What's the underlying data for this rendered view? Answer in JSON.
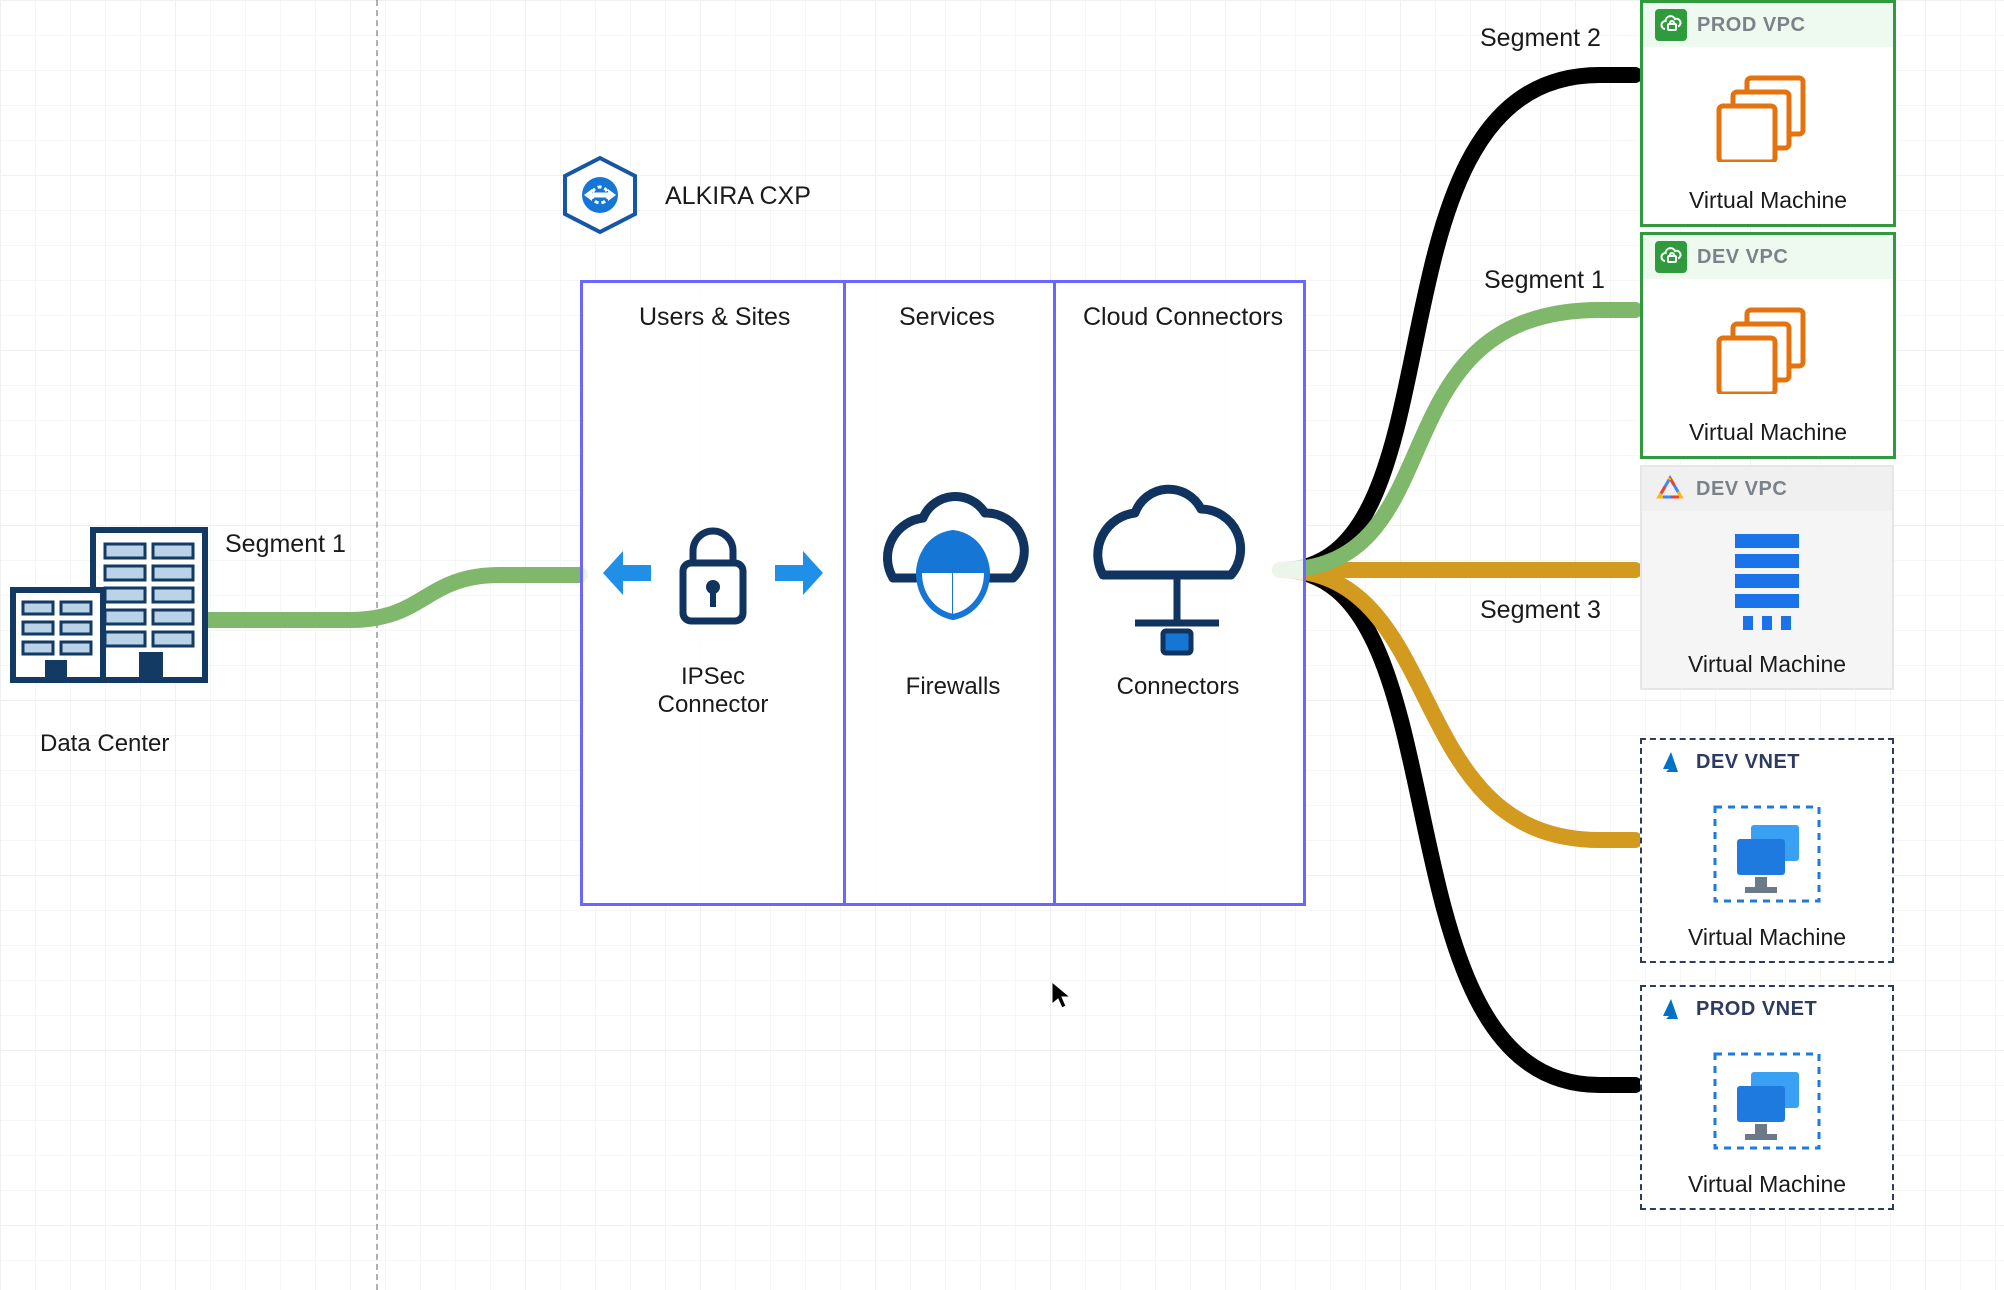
{
  "title": "ALKIRA CXP",
  "left": {
    "segment_label": "Segment 1",
    "datacenter_label": "Data Center"
  },
  "cxp": {
    "users_sites": {
      "header": "Users & Sites",
      "item": "IPSec\nConnector"
    },
    "services": {
      "header": "Services",
      "item": "Firewalls"
    },
    "connectors": {
      "header": "Cloud Connectors",
      "item": "Connectors"
    }
  },
  "segments": {
    "s1": "Segment 1",
    "s2": "Segment 2",
    "s3": "Segment 3"
  },
  "tiles": {
    "aws_prod": {
      "title": "PROD VPC",
      "caption": "Virtual Machine"
    },
    "aws_dev": {
      "title": "DEV VPC",
      "caption": "Virtual Machine"
    },
    "gcp_dev": {
      "title": "DEV VPC",
      "caption": "Virtual Machine"
    },
    "az_dev": {
      "title": "DEV VNET",
      "caption": "Virtual Machine"
    },
    "az_prod": {
      "title": "PROD VNET",
      "caption": "Virtual Machine"
    }
  },
  "colors": {
    "segment1": "#7fb86a",
    "segment2": "#000000",
    "segment3": "#d29a1f",
    "cxp_border": "#6b66ff",
    "aws_green": "#2f9b3c",
    "azure_blue": "#2d6fe0",
    "gcp_accent": "#1a73e8",
    "ec2_orange": "#e4730f",
    "firewall_blue": "#1676d6"
  }
}
